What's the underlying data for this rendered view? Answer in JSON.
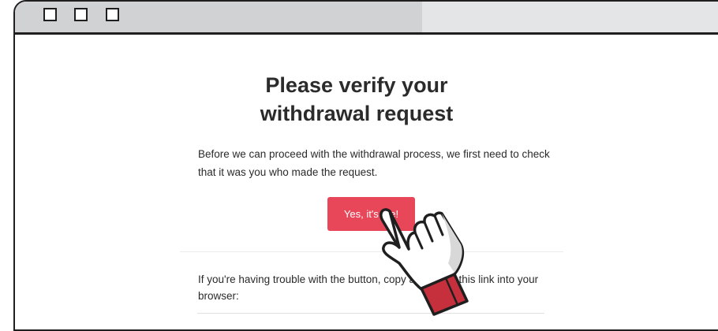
{
  "window": {
    "controls": [
      "window-button-1",
      "window-button-2",
      "window-button-3"
    ]
  },
  "email": {
    "heading_line1": "Please verify your",
    "heading_line2": "withdrawal request",
    "body_line1": "Before we can proceed with the withdrawal process, we first need to check",
    "body_line2": "that it was you who made the request.",
    "button_label": "Yes, it's me!",
    "trouble_line1": "If you're having trouble with the button, copy and paste this link into your",
    "trouble_line2": "browser:"
  },
  "colors": {
    "button": "#e8475a",
    "cuff": "#c62f3c",
    "outline": "#1f1f1f"
  },
  "icons": {
    "pointer": "pointing-hand-icon"
  }
}
